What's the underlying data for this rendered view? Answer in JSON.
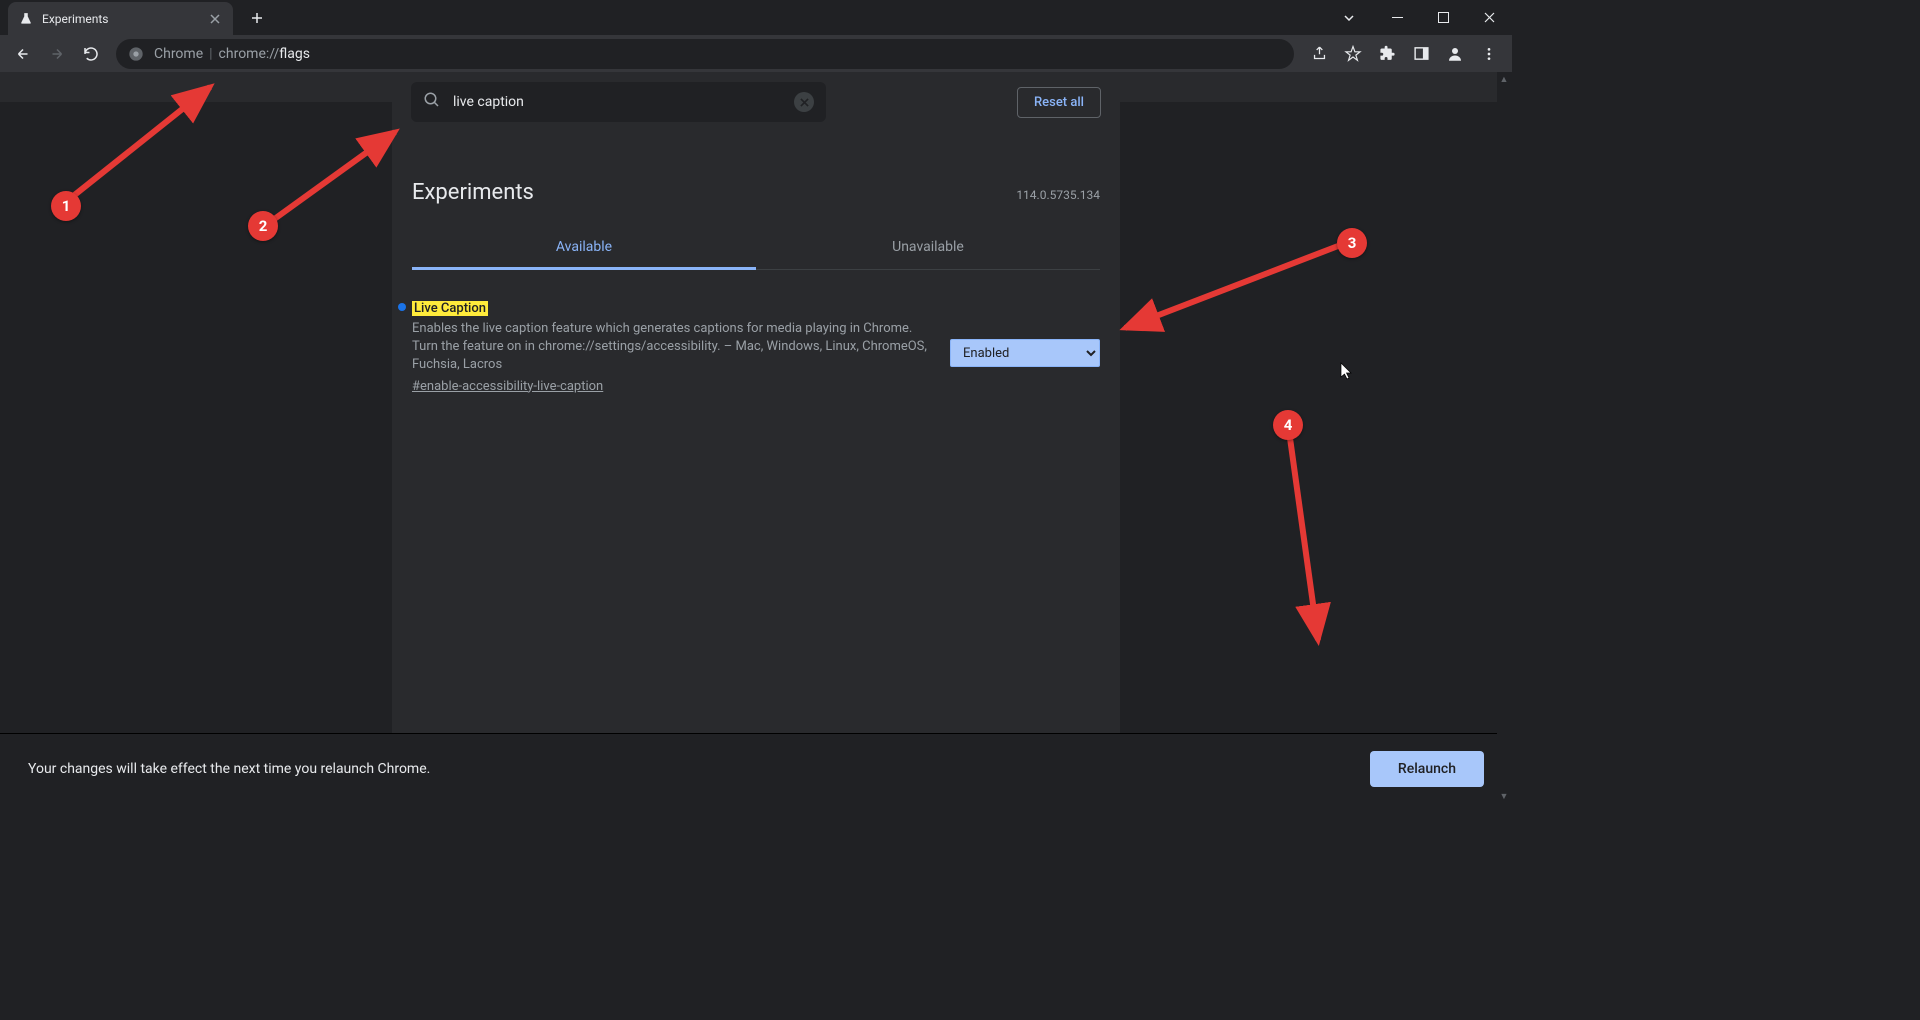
{
  "tab": {
    "title": "Experiments"
  },
  "omnibox": {
    "label": "Chrome",
    "prefix": "chrome://",
    "suffix": "flags"
  },
  "search": {
    "value": "live caption"
  },
  "reset_label": "Reset all",
  "heading": "Experiments",
  "version": "114.0.5735.134",
  "tabs": {
    "available": "Available",
    "unavailable": "Unavailable"
  },
  "flag": {
    "title": "Live Caption",
    "description": "Enables the live caption feature which generates captions for media playing in Chrome. Turn the feature on in chrome://settings/accessibility. – Mac, Windows, Linux, ChromeOS, Fuchsia, Lacros",
    "hash": "#enable-accessibility-live-caption",
    "state": "Enabled"
  },
  "bottom": {
    "message": "Your changes will take effect the next time you relaunch Chrome.",
    "button": "Relaunch"
  },
  "markers": {
    "m1": "1",
    "m2": "2",
    "m3": "3",
    "m4": "4"
  }
}
